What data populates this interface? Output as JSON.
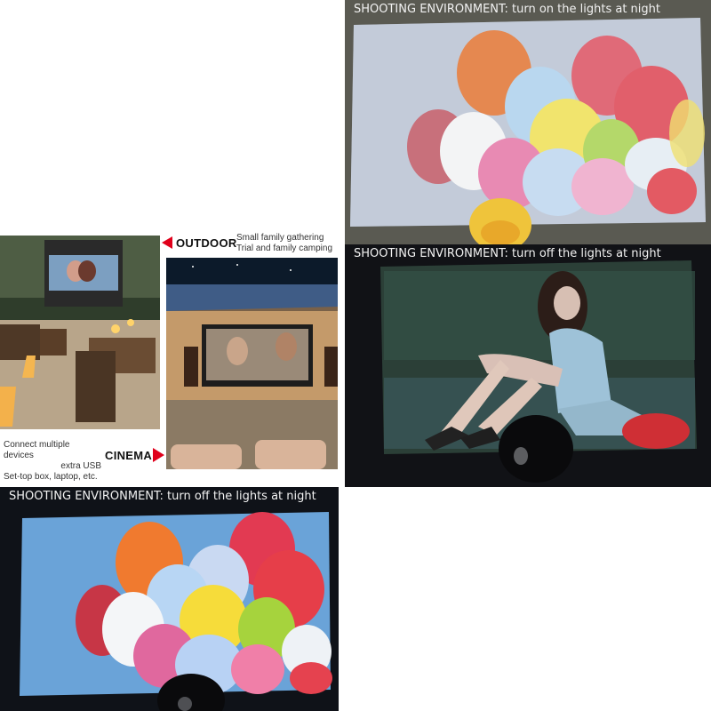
{
  "panels": {
    "lights_on": {
      "caption": "SHOOTING ENVIRONMENT: turn on the lights at night"
    },
    "lights_off_woman": {
      "caption": "SHOOTING ENVIRONMENT: turn off the lights at night"
    },
    "lights_off_balloons": {
      "caption": "SHOOTING ENVIRONMENT: turn off the lights at night"
    }
  },
  "scenes": {
    "outdoor": {
      "label": "OUTDOOR",
      "lines": [
        "Small family gathering",
        "Trial and family camping"
      ]
    },
    "cinema": {
      "label": "CINEMA",
      "lines": [
        "Connect multiple devices",
        "extra USB",
        "Set-top box, laptop, etc."
      ]
    }
  },
  "colors": {
    "arrow_red": "#e0001b",
    "balloon_palette": [
      "#f08a4b",
      "#e5545b",
      "#f3d65a",
      "#c35072",
      "#8fd0e8",
      "#b4e07a",
      "#f4a6c7",
      "#ffffff"
    ]
  }
}
